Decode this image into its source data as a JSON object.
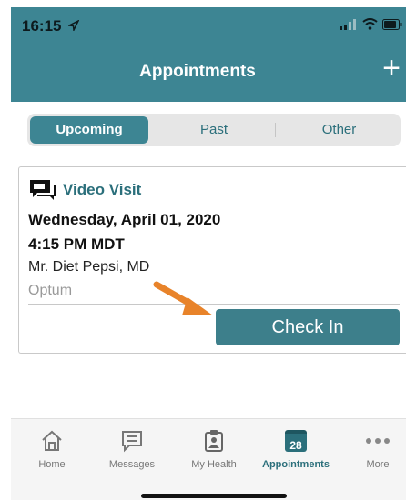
{
  "status": {
    "time": "16:15"
  },
  "header": {
    "title": "Appointments",
    "add_label": "+"
  },
  "tabs": [
    {
      "label": "Upcoming",
      "active": true
    },
    {
      "label": "Past",
      "active": false
    },
    {
      "label": "Other",
      "active": false
    }
  ],
  "appointment": {
    "type": "Video Visit",
    "date": "Wednesday, April 01, 2020",
    "time": "4:15 PM MDT",
    "provider": "Mr. Diet Pepsi, MD",
    "location": "Optum",
    "action_label": "Check In"
  },
  "tabbar": [
    {
      "label": "Home",
      "icon": "home-icon"
    },
    {
      "label": "Messages",
      "icon": "messages-icon"
    },
    {
      "label": "My Health",
      "icon": "clipboard-icon"
    },
    {
      "label": "Appointments",
      "icon": "calendar-icon",
      "badge": "28",
      "active": true
    },
    {
      "label": "More",
      "icon": "more-icon"
    }
  ],
  "colors": {
    "primary": "#3d8593",
    "accent_arrow": "#e8832a"
  }
}
